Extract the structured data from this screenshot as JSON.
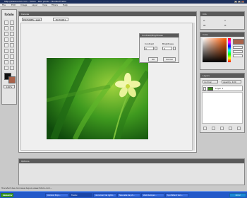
{
  "window": {
    "title": "http://www.sumo.com - Fotolo - Mon photo - Mozilla Firefox"
  },
  "menu": {
    "items": [
      "File",
      "Edit",
      "Image",
      "Layer",
      "View",
      "Filters",
      "Help"
    ]
  },
  "toolbox": {
    "logo": "fotolo",
    "zoom": "100%"
  },
  "canvas": {
    "title": "Canvas",
    "tabs": [
      "PICTURES - web",
      "PICTURE1"
    ]
  },
  "dialog": {
    "title": "Contrast/Brightness",
    "contrast_label": "Contrast",
    "brightness_label": "Brightness",
    "contrast_value": "0",
    "brightness_value": "0",
    "ok": "OK",
    "cancel": "Cancel"
  },
  "info": {
    "title": "Info",
    "x": "X:",
    "y": "Y:",
    "w": "W:",
    "h": "H:"
  },
  "color": {
    "title": "Color"
  },
  "layers": {
    "title": "Layers",
    "mode": "normal",
    "opacity": "opacity: 100",
    "layer_name": "Layer 1"
  },
  "options": {
    "title": "Options"
  },
  "status": {
    "text": "Transfert des données depuis www.fotolo.com..."
  },
  "taskbar": {
    "items": [
      "démarrer",
      "Outlook Expr...",
      "Firefox",
      "document de lightr...",
      "Nouvelle de ph...",
      "Web Remper...",
      "SynthPaint Vari..."
    ],
    "clock": "10:22"
  }
}
